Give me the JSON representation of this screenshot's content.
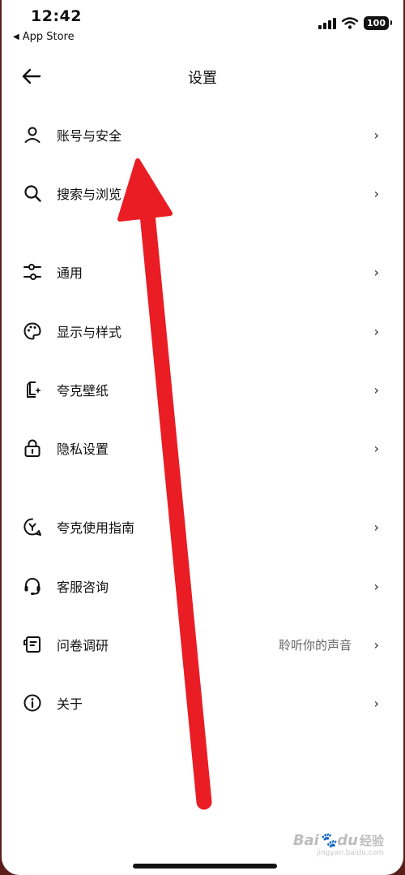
{
  "status_bar": {
    "time": "12:42",
    "back_app": "App Store",
    "battery": "100"
  },
  "nav": {
    "title": "设置"
  },
  "settings_items": [
    {
      "id": "account",
      "label": "账号与安全",
      "icon": "person-icon"
    },
    {
      "id": "search",
      "label": "搜索与浏览",
      "icon": "search-icon"
    },
    {
      "id": "general",
      "label": "通用",
      "icon": "sliders-icon"
    },
    {
      "id": "display",
      "label": "显示与样式",
      "icon": "palette-icon"
    },
    {
      "id": "wallpaper",
      "label": "夸克壁纸",
      "icon": "wallpaper-icon"
    },
    {
      "id": "privacy",
      "label": "隐私设置",
      "icon": "lock-icon"
    },
    {
      "id": "guide",
      "label": "夸克使用指南",
      "icon": "guide-icon"
    },
    {
      "id": "support",
      "label": "客服咨询",
      "icon": "headset-icon"
    },
    {
      "id": "survey",
      "label": "问卷调研",
      "subtext": "聆听你的声音",
      "icon": "survey-icon"
    },
    {
      "id": "about",
      "label": "关于",
      "icon": "info-icon"
    }
  ],
  "chevron": "›",
  "watermark": {
    "brand": "Bai",
    "brand2": "du",
    "suffix": "经验",
    "url": "jingyan.baidu.com"
  },
  "colors": {
    "arrow": "#ea1c24",
    "background_edge": "#5a1f1b"
  }
}
